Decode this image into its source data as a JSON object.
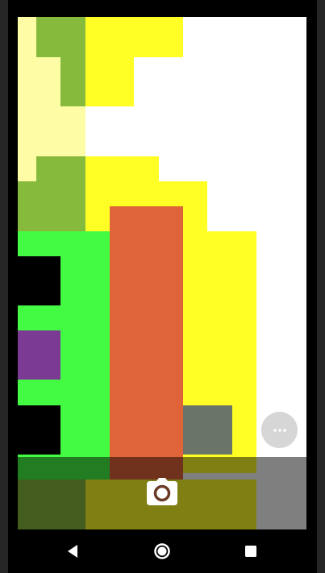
{
  "screen": {
    "background_color": "#ffffff"
  },
  "palette": {
    "pale_yellow": "#fffca6",
    "olive_green": "#86ba3c",
    "yellow": "#ffff26",
    "bright_green": "#44fb44",
    "orange": "#e0643a",
    "purple": "#7b3a93",
    "gray_tile": "#6a7469",
    "black": "#000000"
  },
  "overlay": {
    "color": "rgba(0,0,0,0.5)"
  },
  "camera_button": {
    "icon": "camera-icon"
  },
  "more_button": {
    "icon": "more-horizontal-icon",
    "color": "#d6d6d6"
  },
  "navbar": {
    "back": {
      "icon": "back-triangle-icon"
    },
    "home": {
      "icon": "home-circle-icon"
    },
    "recents": {
      "icon": "recents-square-icon"
    }
  }
}
